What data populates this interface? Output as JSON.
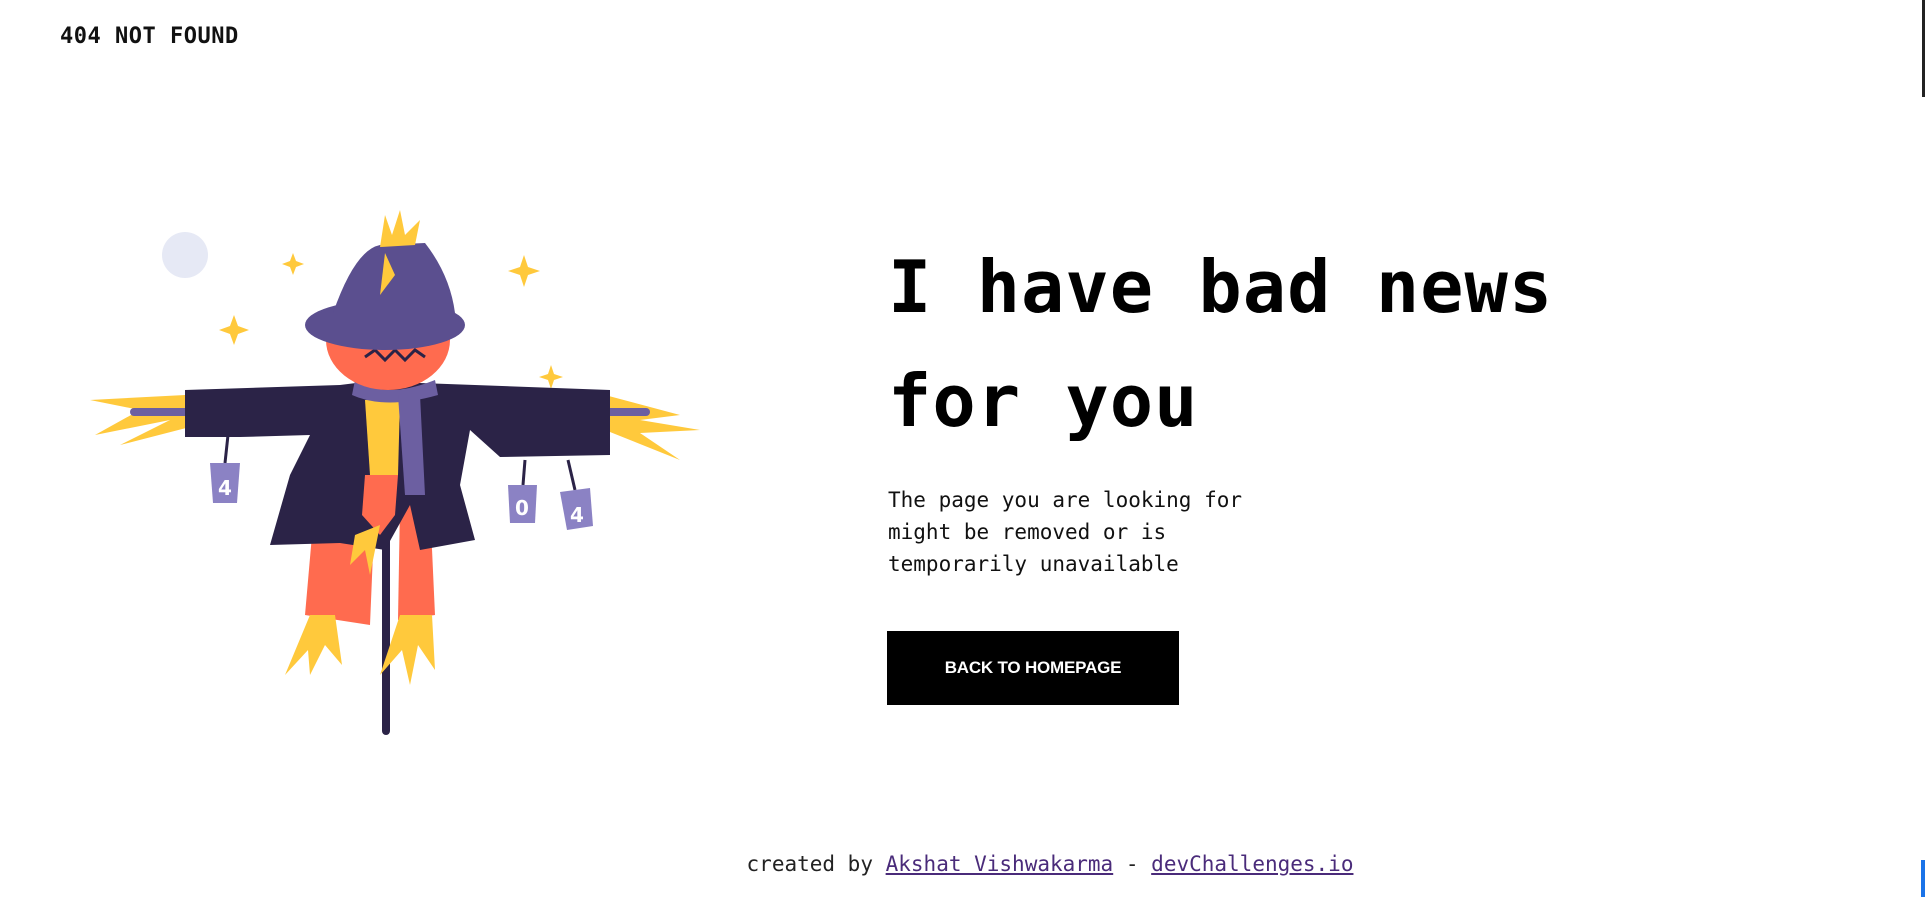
{
  "header": {
    "brand": "404 NOT FOUND"
  },
  "hero": {
    "headline_line1": "I have bad news",
    "headline_line2": "for you",
    "description_line1": "The page you are looking for",
    "description_line2": "might be removed or is",
    "description_line3": "temporarily unavailable",
    "cta_label": "BACK TO HOMEPAGE"
  },
  "illustration": {
    "can_left_label": "4",
    "can_mid_label": "0",
    "can_right_label": "4",
    "colors": {
      "hat": "#5b4f8f",
      "coat": "#2b2347",
      "face": "#ff6b4f",
      "straw": "#ffc93c",
      "scarf": "#6c5fa1",
      "moon": "#e6e9f5"
    }
  },
  "footer": {
    "prefix": "created by",
    "author": "Akshat Vishwakarma",
    "separator": "-",
    "site": "devChallenges.io"
  }
}
